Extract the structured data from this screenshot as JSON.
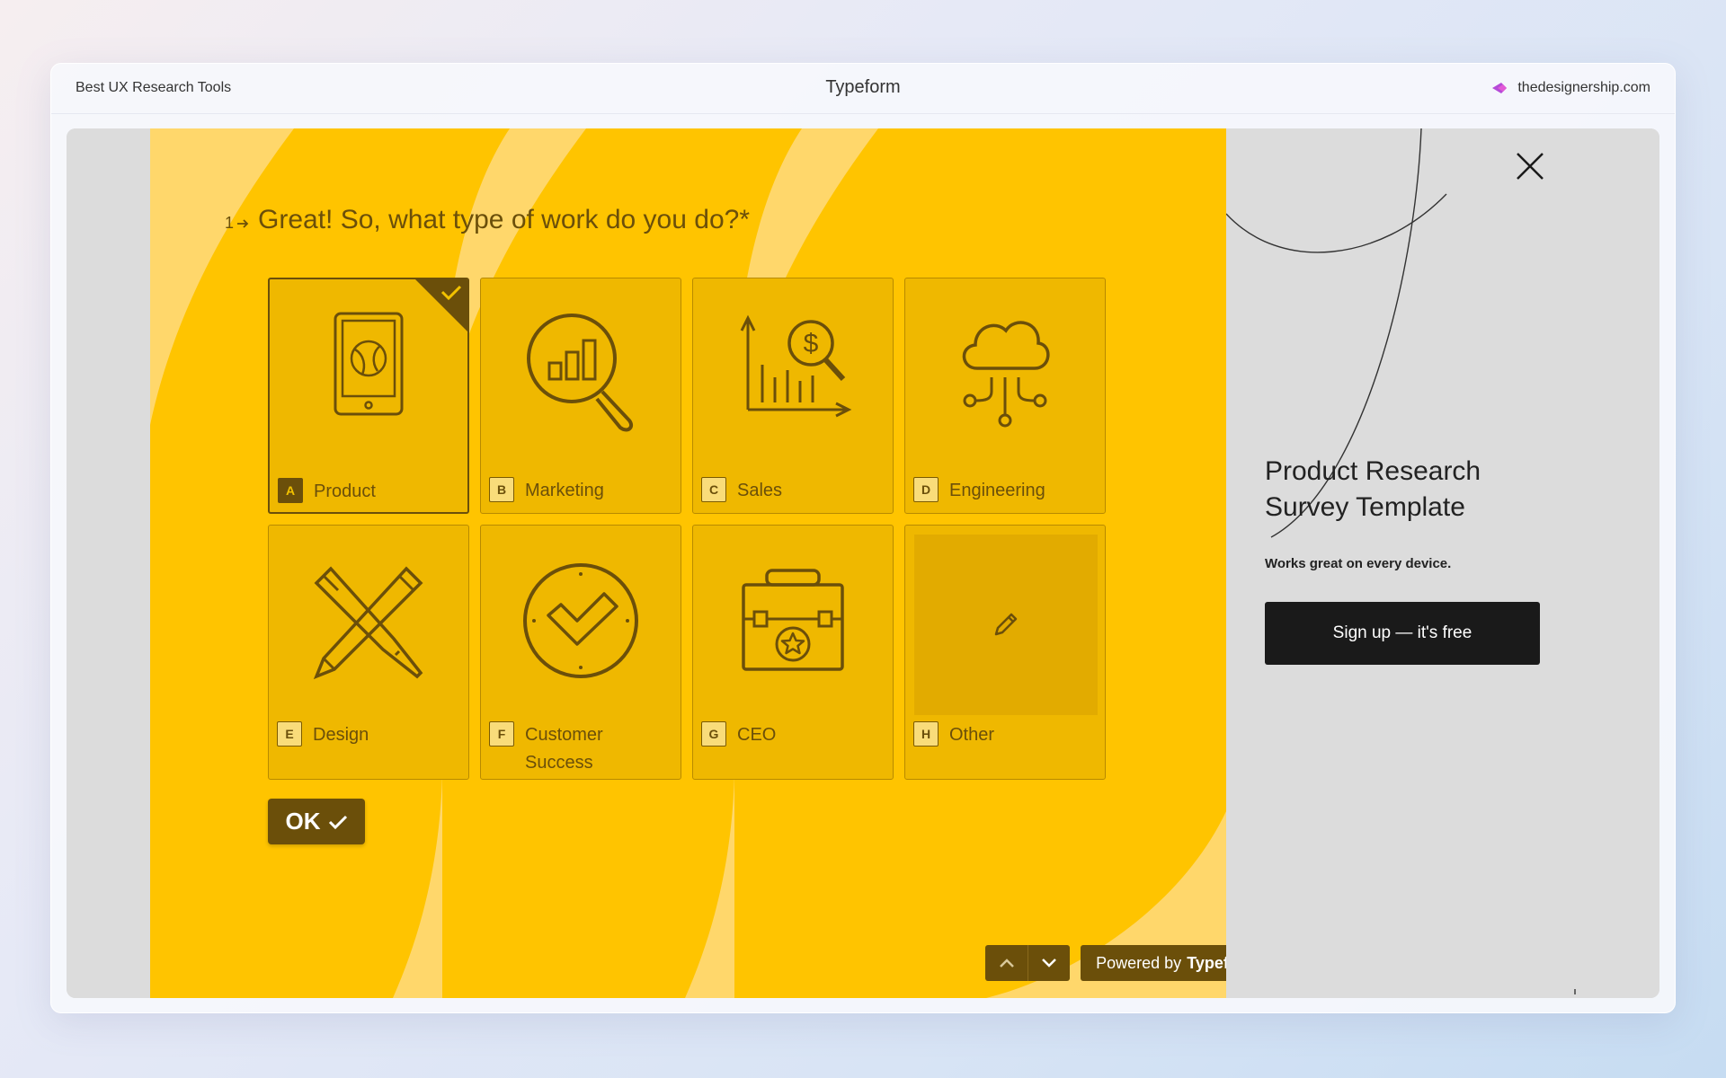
{
  "topbar": {
    "left_label": "Best UX Research Tools",
    "title": "Typeform",
    "site": "thedesignership.com"
  },
  "question": {
    "number": "1",
    "text": "Great! So, what type of work do you do?*"
  },
  "choices": [
    {
      "key": "A",
      "label": "Product",
      "selected": true,
      "icon": "tablet-icon"
    },
    {
      "key": "B",
      "label": "Marketing",
      "selected": false,
      "icon": "magnifier-chart-icon"
    },
    {
      "key": "C",
      "label": "Sales",
      "selected": false,
      "icon": "dollar-chart-icon"
    },
    {
      "key": "D",
      "label": "Engineering",
      "selected": false,
      "icon": "cloud-network-icon"
    },
    {
      "key": "E",
      "label": "Design",
      "selected": false,
      "icon": "pencil-pen-icon"
    },
    {
      "key": "F",
      "label": "Customer Success",
      "selected": false,
      "icon": "check-circle-icon"
    },
    {
      "key": "G",
      "label": "CEO",
      "selected": false,
      "icon": "briefcase-star-icon"
    },
    {
      "key": "H",
      "label": "Other",
      "selected": false,
      "icon": "pencil-icon"
    }
  ],
  "ok_label": "OK",
  "powered": {
    "prefix": "Powered by",
    "brand": "Typeform"
  },
  "side": {
    "title": "Product Research Survey Template",
    "subtitle": "Works great on every device.",
    "signup_label": "Sign up — it's free"
  },
  "colors": {
    "form_bg": "#ffc400",
    "card": "#efb800",
    "accent_dark": "#6b4f0a",
    "side_bg": "#dcdcdc",
    "signup_bg": "#1a1a1a"
  }
}
